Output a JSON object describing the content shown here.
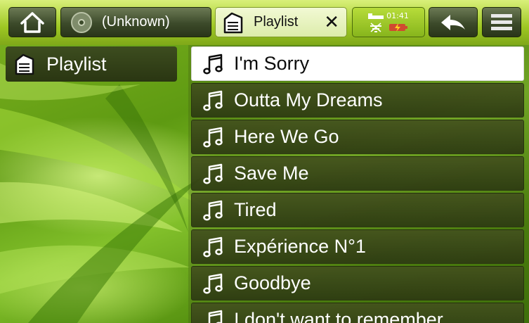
{
  "topbar": {
    "home_icon": "home-icon",
    "tabs": [
      {
        "label": "(Unknown)",
        "icon": "disc-icon"
      },
      {
        "label": "Playlist",
        "icon": "playlist-icon",
        "active": true
      }
    ],
    "status": {
      "time": "01:41"
    },
    "back_icon": "back-arrow-icon",
    "menu_icon": "menu-icon"
  },
  "left_panel": {
    "label": "Playlist",
    "icon": "playlist-icon"
  },
  "playlist": {
    "items": [
      {
        "title": "I'm Sorry",
        "selected": true
      },
      {
        "title": "Outta My Dreams"
      },
      {
        "title": "Here We Go"
      },
      {
        "title": "Save Me"
      },
      {
        "title": "Tired"
      },
      {
        "title": "Expérience N°1"
      },
      {
        "title": "Goodbye"
      },
      {
        "title": "I don't want to remember"
      }
    ]
  },
  "colors": {
    "accent": "#9ec723",
    "selected_row": "#ffffff",
    "row_dark": "#3a4a18"
  }
}
